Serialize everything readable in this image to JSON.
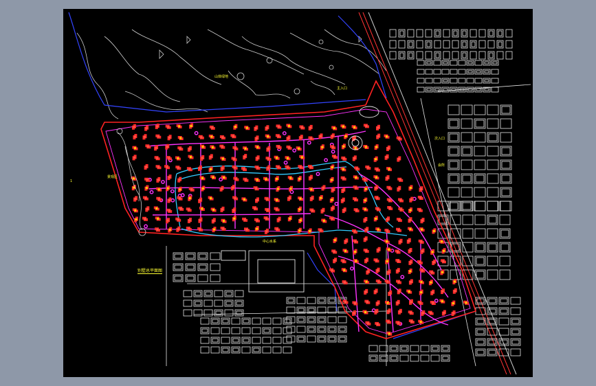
{
  "app": {
    "name": "CAD drawing viewer",
    "colors": {
      "frame": "#8e98a8",
      "canvas": "#000000",
      "boundary_red": "#ff2222",
      "magenta_path": "#ff33ff",
      "cyan_water": "#33ccff",
      "white_lines": "#e6e6e6",
      "blue_line": "#3344ff",
      "yellow_text": "#ffff33",
      "house_red": "#ff2a2a",
      "house_yellow": "#ffcc00"
    }
  },
  "drawing": {
    "plan_title": "别墅总平面图",
    "labels": {
      "hill": "山体绿地",
      "north_gate": "主入口",
      "east_gate": "次入口",
      "west_park": "景观区",
      "south_center": "中心水系",
      "west_margin": "",
      "center_club": "会所",
      "far_west": "1"
    }
  }
}
